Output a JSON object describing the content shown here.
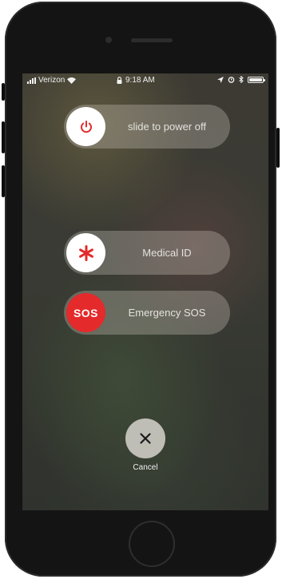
{
  "status_bar": {
    "carrier": "Verizon",
    "time": "9:18 AM",
    "icons": [
      "signal-bars-icon",
      "wifi-icon",
      "lock-icon",
      "location-arrow-icon",
      "alarm-icon",
      "bluetooth-icon",
      "battery-icon"
    ]
  },
  "power_slider": {
    "label": "slide to power off",
    "icon": "power-icon"
  },
  "medical_slider": {
    "label": "Medical ID",
    "icon": "asterisk-icon"
  },
  "sos_slider": {
    "label": "Emergency SOS",
    "knob_text": "SOS"
  },
  "cancel": {
    "label": "Cancel",
    "icon": "close-icon"
  },
  "colors": {
    "accent_red": "#E42A2A",
    "knob_white": "#FFFFFF"
  }
}
